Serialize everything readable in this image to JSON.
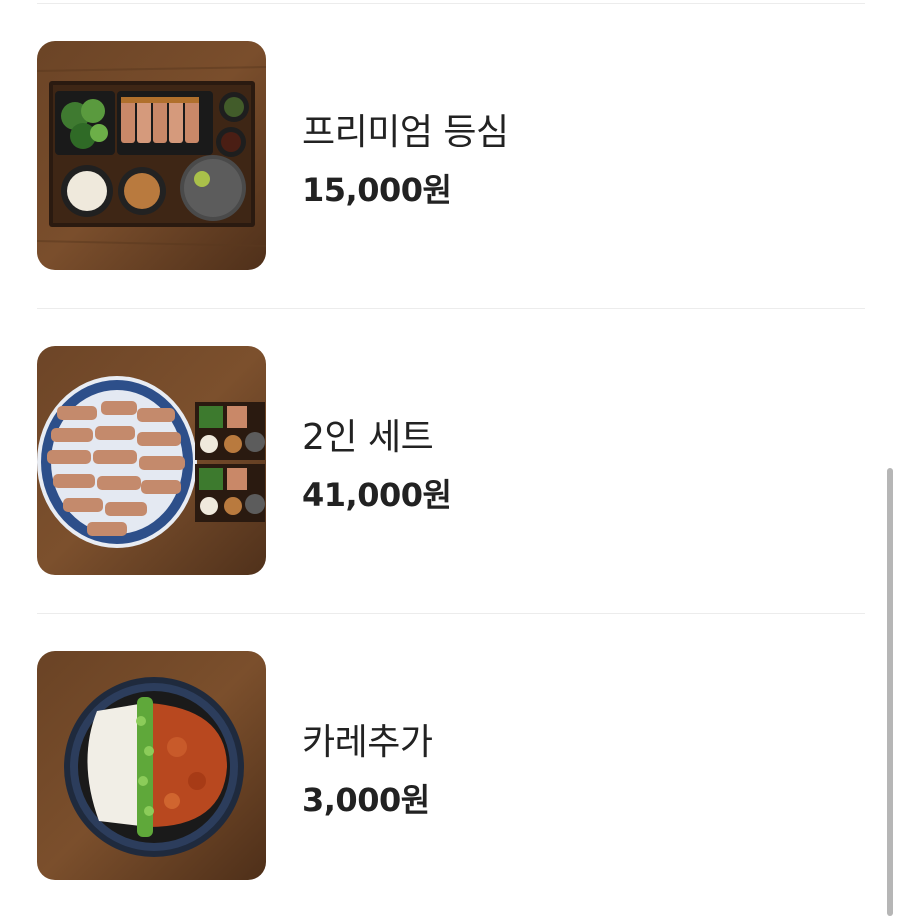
{
  "menu": {
    "items": [
      {
        "name": "프리미엄 등심",
        "price": "15,000원",
        "image": "premium-sirloin-set-photo"
      },
      {
        "name": "2인 세트",
        "price": "41,000원",
        "image": "two-person-set-photo"
      },
      {
        "name": "카레추가",
        "price": "3,000원",
        "image": "curry-addon-photo"
      }
    ]
  }
}
